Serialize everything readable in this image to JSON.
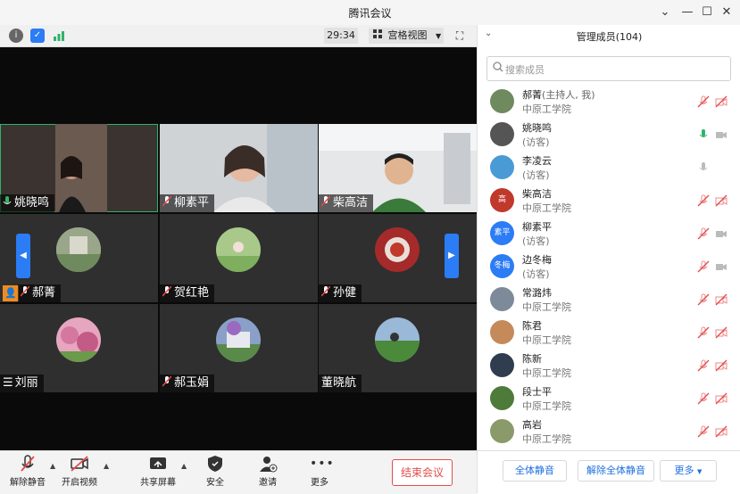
{
  "window": {
    "title": "腾讯会议"
  },
  "meeting": {
    "timer": "29:34",
    "view_label": "宫格视图",
    "end_label": "结束会议"
  },
  "colors": {
    "accent": "#2b7cf5",
    "danger": "#e34b4b",
    "speaking": "#2fb36b"
  },
  "tiles": [
    {
      "name": "姚晓鸣",
      "mic": "on"
    },
    {
      "name": "柳素平",
      "mic": "off"
    },
    {
      "name": "柴高洁",
      "mic": "off"
    },
    {
      "name": "郝菁",
      "mic": "off"
    },
    {
      "name": "贺红艳",
      "mic": "off"
    },
    {
      "name": "孙健",
      "mic": "off"
    },
    {
      "name": "刘丽",
      "mic": "off"
    },
    {
      "name": "郝玉娟",
      "mic": "off"
    },
    {
      "name": "董晓航",
      "mic": "off"
    }
  ],
  "toolbar": [
    {
      "label": "解除静音",
      "icon": "mic-muted-icon"
    },
    {
      "label": "开启视频",
      "icon": "video-off-icon"
    },
    {
      "label": "共享屏幕",
      "icon": "share-screen-icon"
    },
    {
      "label": "安全",
      "icon": "shield-icon"
    },
    {
      "label": "邀请",
      "icon": "invite-icon"
    },
    {
      "label": "更多",
      "icon": "more-icon"
    }
  ],
  "panel": {
    "title": "管理成员(104)",
    "search_placeholder": "搜索成员",
    "members": [
      {
        "name": "郝菁",
        "role": "(主持人, 我)",
        "sub": "中原工学院",
        "avatar": "",
        "avatar_color": "#6f8a5e",
        "mic": "off",
        "video": "off"
      },
      {
        "name": "姚晓鸣",
        "role": "",
        "sub": "(访客)",
        "avatar": "",
        "avatar_color": "#555",
        "mic": "on",
        "video": "gray"
      },
      {
        "name": "李凌云",
        "role": "",
        "sub": "(访客)",
        "avatar": "",
        "avatar_color": "#4a9ad6",
        "mic": "gray",
        "video": "none"
      },
      {
        "name": "柴高洁",
        "role": "",
        "sub": "中原工学院",
        "avatar": "高",
        "avatar_color": "#c0392b",
        "mic": "off",
        "video": "off"
      },
      {
        "name": "柳素平",
        "role": "",
        "sub": "(访客)",
        "avatar": "素平",
        "avatar_color": "#2b7cf5",
        "mic": "off",
        "video": "gray"
      },
      {
        "name": "边冬梅",
        "role": "",
        "sub": "(访客)",
        "avatar": "冬梅",
        "avatar_color": "#2b7cf5",
        "mic": "off",
        "video": "gray"
      },
      {
        "name": "常潞炜",
        "role": "",
        "sub": "中原工学院",
        "avatar": "",
        "avatar_color": "#7d8a99",
        "mic": "off",
        "video": "off"
      },
      {
        "name": "陈君",
        "role": "",
        "sub": "中原工学院",
        "avatar": "",
        "avatar_color": "#c58a5a",
        "mic": "off",
        "video": "off"
      },
      {
        "name": "陈新",
        "role": "",
        "sub": "中原工学院",
        "avatar": "",
        "avatar_color": "#2f3d4f",
        "mic": "off",
        "video": "off"
      },
      {
        "name": "段士平",
        "role": "",
        "sub": "中原工学院",
        "avatar": "",
        "avatar_color": "#4e7a3a",
        "mic": "off",
        "video": "off"
      },
      {
        "name": "高岩",
        "role": "",
        "sub": "中原工学院",
        "avatar": "",
        "avatar_color": "#8a9a6a",
        "mic": "off",
        "video": "off"
      }
    ],
    "mute_all": "全体静音",
    "unmute_all": "解除全体静音",
    "more": "更多"
  }
}
